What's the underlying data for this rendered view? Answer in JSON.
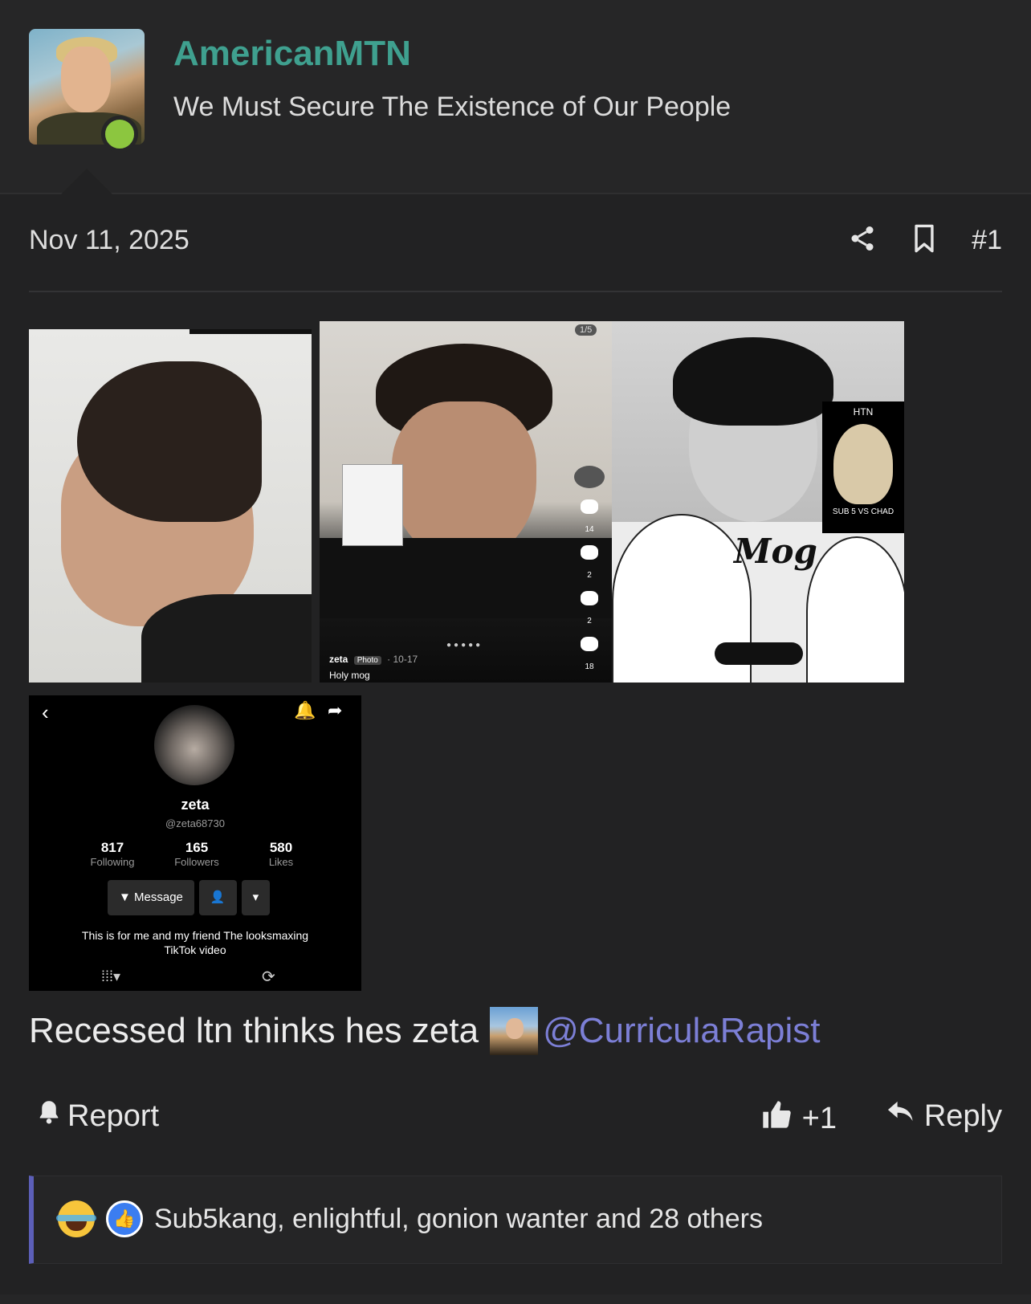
{
  "user": {
    "name": "AmericanMTN",
    "title": "We Must Secure The Existence of Our People"
  },
  "post": {
    "date": "Nov 11, 2025",
    "number": "#1",
    "text": "Recessed ltn thinks hes zeta",
    "mention": "@CurriculaRapist"
  },
  "images": {
    "tiktok": {
      "counter": "1/5",
      "likes": "14",
      "comments": "2",
      "saves": "2",
      "shares": "18",
      "author": "zeta",
      "badge": "Photo",
      "date": "· 10-17",
      "caption": "Holy mog"
    },
    "meme": {
      "box_title": "HTN",
      "box_caption": "SUB 5 VS CHAD",
      "word": "Mog"
    },
    "profile": {
      "name": "zeta",
      "handle": "@zeta68730",
      "stats": [
        {
          "value": "817",
          "label": "Following"
        },
        {
          "value": "165",
          "label": "Followers"
        },
        {
          "value": "580",
          "label": "Likes"
        }
      ],
      "message_button": "Message",
      "bio_line1": "This is for me and my friend The looksmaxing",
      "bio_line2": "TikTok video"
    }
  },
  "actions": {
    "report": "Report",
    "like_count": "+1",
    "reply": "Reply"
  },
  "reactions": {
    "text": "Sub5kang, enlightful, gonion wanter and 28 others"
  },
  "colors": {
    "username": "#3fa08f",
    "mention": "#7c7fd6",
    "online": "#8cc63f",
    "reaction_bar": "#5c5fb8"
  }
}
